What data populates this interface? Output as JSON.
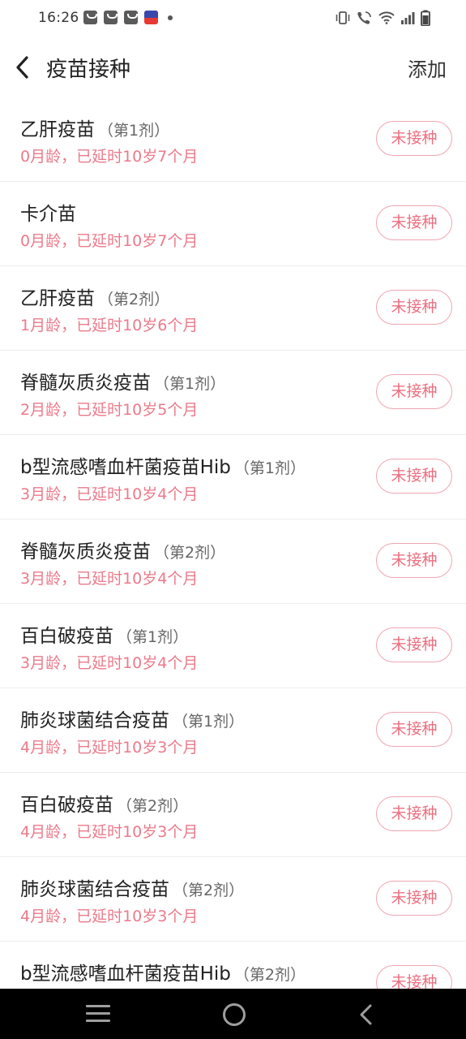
{
  "status_bar": {
    "time": "16:26"
  },
  "header": {
    "title": "疫苗接种",
    "add_label": "添加"
  },
  "vaccines": [
    {
      "name": "乙肝疫苗",
      "dose": "（第1剂）",
      "age": "0月龄，已延时10岁7个月",
      "status": "未接种"
    },
    {
      "name": "卡介苗",
      "dose": "",
      "age": "0月龄，已延时10岁7个月",
      "status": "未接种"
    },
    {
      "name": "乙肝疫苗",
      "dose": "（第2剂）",
      "age": "1月龄，已延时10岁6个月",
      "status": "未接种"
    },
    {
      "name": "脊髓灰质炎疫苗",
      "dose": "（第1剂）",
      "age": "2月龄，已延时10岁5个月",
      "status": "未接种"
    },
    {
      "name": "b型流感嗜血杆菌疫苗Hib",
      "dose": "（第1剂）",
      "age": "3月龄，已延时10岁4个月",
      "status": "未接种"
    },
    {
      "name": "脊髓灰质炎疫苗",
      "dose": "（第2剂）",
      "age": "3月龄，已延时10岁4个月",
      "status": "未接种"
    },
    {
      "name": "百白破疫苗",
      "dose": "（第1剂）",
      "age": "3月龄，已延时10岁4个月",
      "status": "未接种"
    },
    {
      "name": "肺炎球菌结合疫苗",
      "dose": "（第1剂）",
      "age": "4月龄，已延时10岁3个月",
      "status": "未接种"
    },
    {
      "name": "百白破疫苗",
      "dose": "（第2剂）",
      "age": "4月龄，已延时10岁3个月",
      "status": "未接种"
    },
    {
      "name": "肺炎球菌结合疫苗",
      "dose": "（第2剂）",
      "age": "4月龄，已延时10岁3个月",
      "status": "未接种"
    },
    {
      "name": "b型流感嗜血杆菌疫苗Hib",
      "dose": "（第2剂）",
      "age": "",
      "status": "未接种"
    }
  ],
  "colors": {
    "age_text": "#ec7a8a",
    "status_border": "#f0a6b1",
    "status_text": "#ec6f80"
  },
  "icons": {
    "back": "chevron-left-icon",
    "nav_menu": "menu-icon",
    "nav_home": "home-circle-icon",
    "nav_back": "chevron-left-icon"
  }
}
